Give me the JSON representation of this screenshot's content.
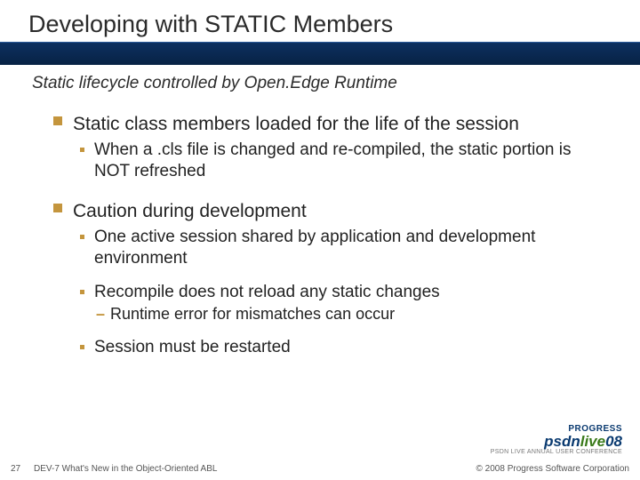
{
  "slide": {
    "title": "Developing with STATIC Members",
    "subtitle": "Static lifecycle controlled by Open.Edge Runtime",
    "bullets": [
      {
        "level": 1,
        "text": "Static class members loaded for the life of the session"
      },
      {
        "level": 2,
        "text": "When a .cls file is changed and re-compiled, the static portion is NOT refreshed"
      },
      {
        "level": 1,
        "text": "Caution during development"
      },
      {
        "level": 2,
        "text": "One active session shared by application and development environment"
      },
      {
        "level": 2,
        "text": "Recompile does not reload any static changes"
      },
      {
        "level": 3,
        "text": "Runtime error for mismatches can occur"
      },
      {
        "level": 2,
        "text": "Session must be restarted"
      }
    ]
  },
  "footer": {
    "slide_number": "27",
    "title": "DEV-7 What's New in the Object-Oriented ABL",
    "copyright": "© 2008 Progress Software Corporation"
  },
  "logo": {
    "top": "PROGRESS",
    "psdn": "psdn",
    "live": "live",
    "year": "08",
    "sub": "PSDN LIVE ANNUAL USER CONFERENCE"
  }
}
